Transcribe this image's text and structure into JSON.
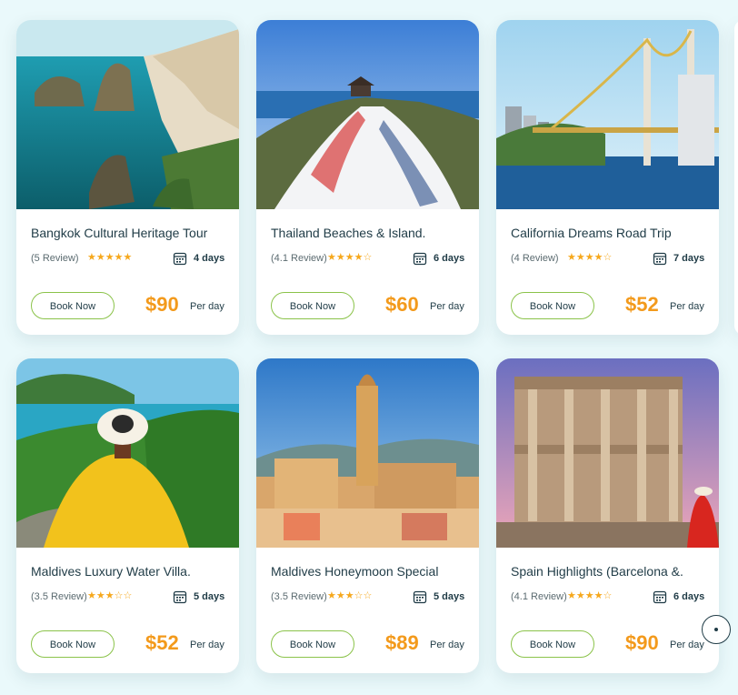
{
  "booking": {
    "label": "Book Now",
    "per": "Per day"
  },
  "tours": [
    {
      "title": "Bangkok Cultural Heritage Tour",
      "review": "(5 Review)",
      "stars": "★★★★★",
      "days": "4 days",
      "price": "$90"
    },
    {
      "title": "Thailand Beaches & Island.",
      "review": "(4.1 Review)",
      "stars": "★★★★☆",
      "days": "6 days",
      "price": "$60"
    },
    {
      "title": "California Dreams Road Trip",
      "review": "(4 Review)",
      "stars": "★★★★☆",
      "days": "7 days",
      "price": "$52"
    },
    {
      "title": "Maldives Luxury Water Villa.",
      "review": "(3.5 Review)",
      "stars": "★★★☆☆",
      "days": "5 days",
      "price": "$52"
    },
    {
      "title": "Maldives Honeymoon Special",
      "review": "(3.5 Review)",
      "stars": "★★★☆☆",
      "days": "5 days",
      "price": "$89"
    },
    {
      "title": "Spain Highlights (Barcelona &.",
      "review": "(4.1 Review)",
      "stars": "★★★★☆",
      "days": "6 days",
      "price": "$90"
    }
  ],
  "colors": {
    "accent": "#f39a1c",
    "button_border": "#8bc34a",
    "text": "#1f3b46",
    "background": "#eaf9fb"
  }
}
